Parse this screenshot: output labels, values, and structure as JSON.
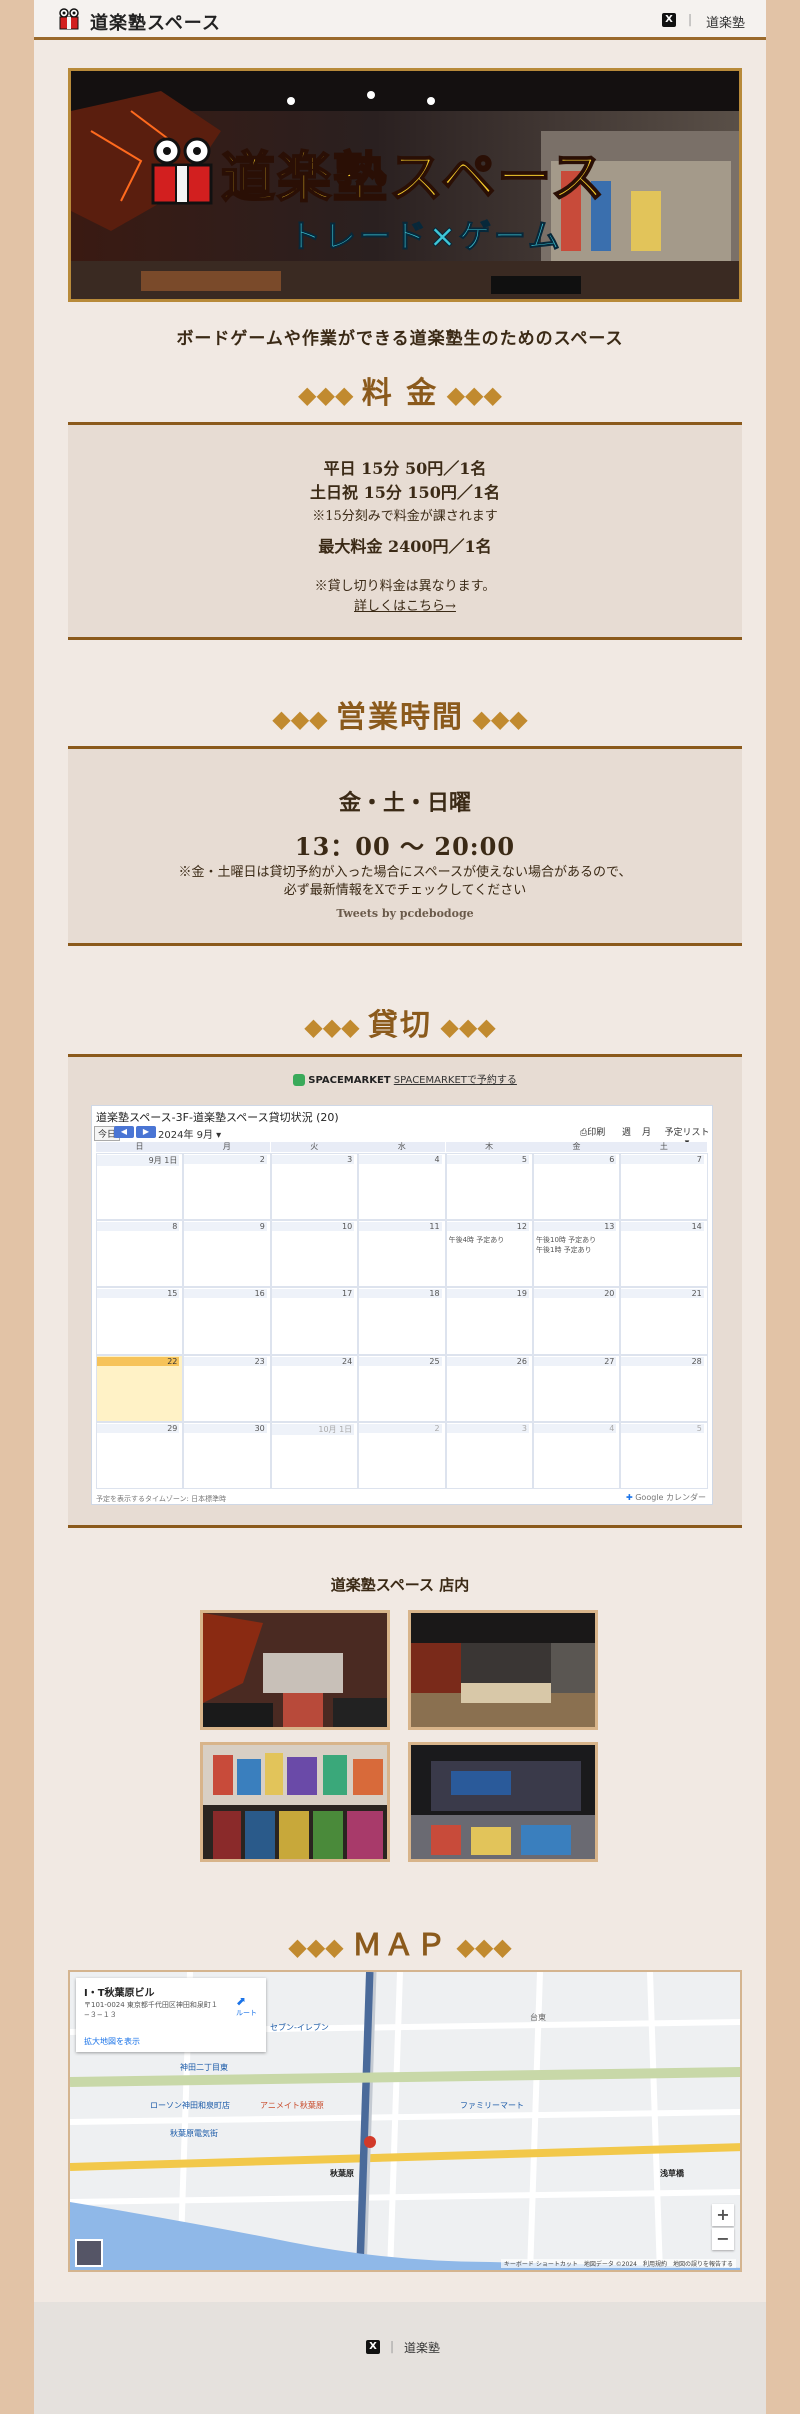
{
  "header": {
    "site_title": "道楽塾スペース",
    "x_icon": "x-logo-icon",
    "x_glyph": "X",
    "separator": "|",
    "nav_link": "道楽塾"
  },
  "hero": {
    "title": "道楽塾スペース",
    "subtitle": "トレード×ゲーム"
  },
  "tagline": "ボードゲームや作業ができる道楽塾生のためのスペース",
  "pricing": {
    "heading": "料 金",
    "weekday": "平日 15分 50円／1名",
    "weekend": "土日祝 15分 150円／1名",
    "note_increments": "※15分刻みで料金が課されます",
    "max": "最大料金 2400円／1名",
    "note_charter": "※貸し切り料金は異なります。",
    "details_link": "詳しくはこちら→"
  },
  "hours": {
    "heading": "営業時間",
    "days": "金・土・日曜",
    "time": "13：00 〜 20:00",
    "note_line1": "※金・土曜日は貸切予約が入った場合にスペースが使えない場合があるので、",
    "note_line2": "必ず最新情報をXでチェックしてください",
    "tweets": "Tweets by pcdebodoge"
  },
  "charter": {
    "heading": "貸切",
    "spacemarket_brand": "SPACEMARKET",
    "spacemarket_link": "SPACEMARKETで予約する",
    "calendar": {
      "title": "道楽塾スペース-3F-道楽塾スペース貸切状況 (20)",
      "today_btn": "今日",
      "prev": "◀",
      "next": "▶",
      "month": "2024年 9月 ▾",
      "print": "印刷",
      "view_week": "週",
      "view_month": "月",
      "view_agenda": "予定リスト ▾",
      "weekdays": [
        "日",
        "月",
        "火",
        "水",
        "木",
        "金",
        "土"
      ],
      "days": [
        "9月 1日",
        "2",
        "3",
        "4",
        "5",
        "6",
        "7",
        "8",
        "9",
        "10",
        "11",
        "12",
        "13",
        "14",
        "15",
        "16",
        "17",
        "18",
        "19",
        "20",
        "21",
        "22",
        "23",
        "24",
        "25",
        "26",
        "27",
        "28",
        "29",
        "30",
        "10月 1日",
        "2",
        "3",
        "4",
        "5"
      ],
      "events": {
        "12": [
          "午後4時 予定あり"
        ],
        "13": [
          "午後10時 予定あり",
          "午後1時 予定あり"
        ]
      },
      "today_index": 21,
      "footer": "予定を表示するタイムゾーン: 日本標準時",
      "gcal": "Google カレンダー"
    }
  },
  "gallery": {
    "heading": "道楽塾スペース 店内"
  },
  "map": {
    "heading": "ＭＡＰ",
    "place_name": "I・T秋葉原ビル",
    "address": "〒101-0024 東京都千代田区神田和泉町１−３−１３",
    "route": "ルート",
    "larger_map": "拡大地図を表示",
    "zoom_in": "+",
    "zoom_out": "−",
    "attribution": "キーボード ショートカット　地図データ ©2024　利用規約　地図の誤りを報告する",
    "labels": [
      "秋葉原",
      "神田二丁目東",
      "ローソン神田和泉町店",
      "アニメイト秋葉原",
      "ファミリーマート",
      "セブン-イレブン",
      "浅草橋",
      "台東",
      "秋葉原電気街"
    ]
  },
  "footer": {
    "x_glyph": "X",
    "separator": "|",
    "link": "道楽塾"
  }
}
